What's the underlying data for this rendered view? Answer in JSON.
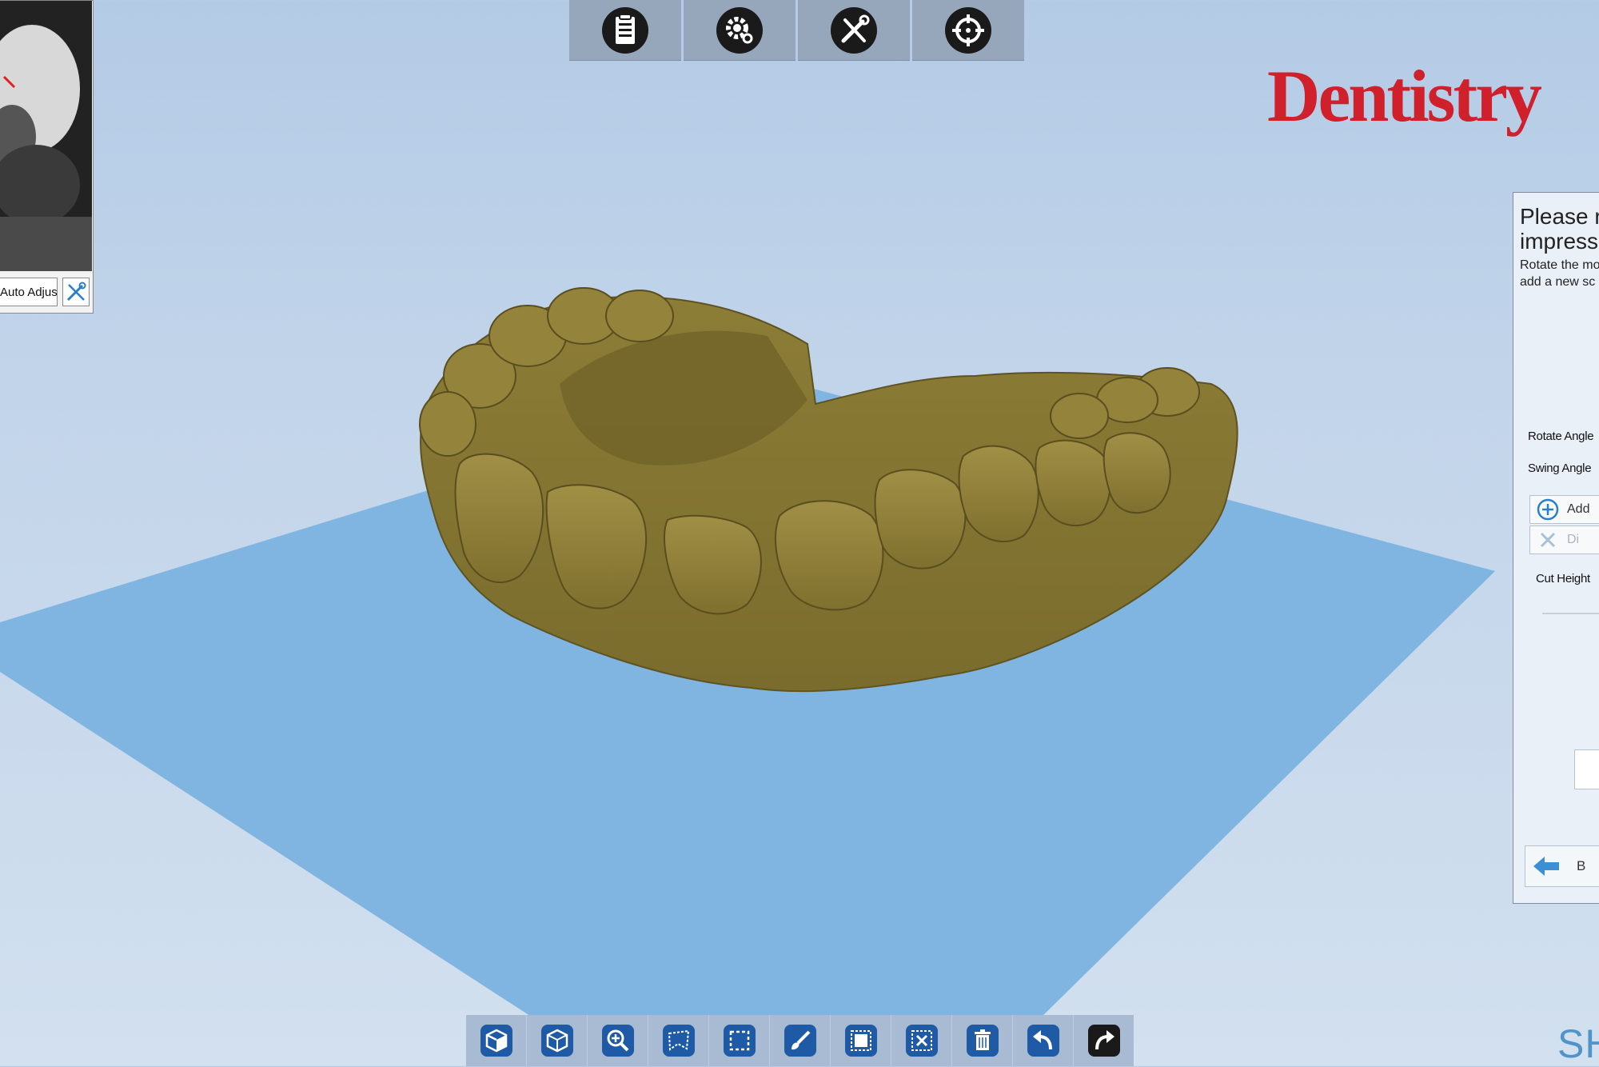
{
  "top_toolbar": {
    "buttons": [
      {
        "name": "notes",
        "icon": "clipboard-list-icon"
      },
      {
        "name": "settings",
        "icon": "gear-icon"
      },
      {
        "name": "tools",
        "icon": "wrench-screwdriver-icon"
      },
      {
        "name": "calibrate",
        "icon": "crosshair-icon"
      }
    ]
  },
  "camera_panel": {
    "auto_adjust_label": "Auto Adjust",
    "tool_icon": "wrench-screwdriver-icon"
  },
  "logo": {
    "text": "Dentistry",
    "color": "#d0202c"
  },
  "side_panel": {
    "title_line1": "Please re",
    "title_line2": "impressio",
    "desc_line1": "Rotate the mo",
    "desc_line2": "add a new sc",
    "rotate_angle_label": "Rotate Angle",
    "swing_angle_label": "Swing Angle",
    "add_button_label": "Add",
    "discard_button_label": "Di",
    "cut_height_label": "Cut Height",
    "back_button_label": "B"
  },
  "brand_corner": "SH",
  "bottom_toolbar": {
    "buttons": [
      {
        "name": "view-front",
        "icon": "cube-front-icon"
      },
      {
        "name": "view-wireframe",
        "icon": "cube-wireframe-icon"
      },
      {
        "name": "zoom",
        "icon": "zoom-in-icon"
      },
      {
        "name": "lasso-select",
        "icon": "lasso-select-icon"
      },
      {
        "name": "rect-select",
        "icon": "rectangle-select-icon"
      },
      {
        "name": "brush-select",
        "icon": "brush-icon"
      },
      {
        "name": "select-all",
        "icon": "select-all-icon"
      },
      {
        "name": "invert-select",
        "icon": "invert-selection-icon"
      },
      {
        "name": "delete",
        "icon": "trash-icon"
      },
      {
        "name": "undo",
        "icon": "undo-icon"
      },
      {
        "name": "redo",
        "icon": "redo-icon"
      }
    ]
  },
  "colors": {
    "background": "#c3d5ea",
    "plane": "#7fb5e0",
    "model": "#8a7a36",
    "icon_blue": "#1f5aa6"
  }
}
